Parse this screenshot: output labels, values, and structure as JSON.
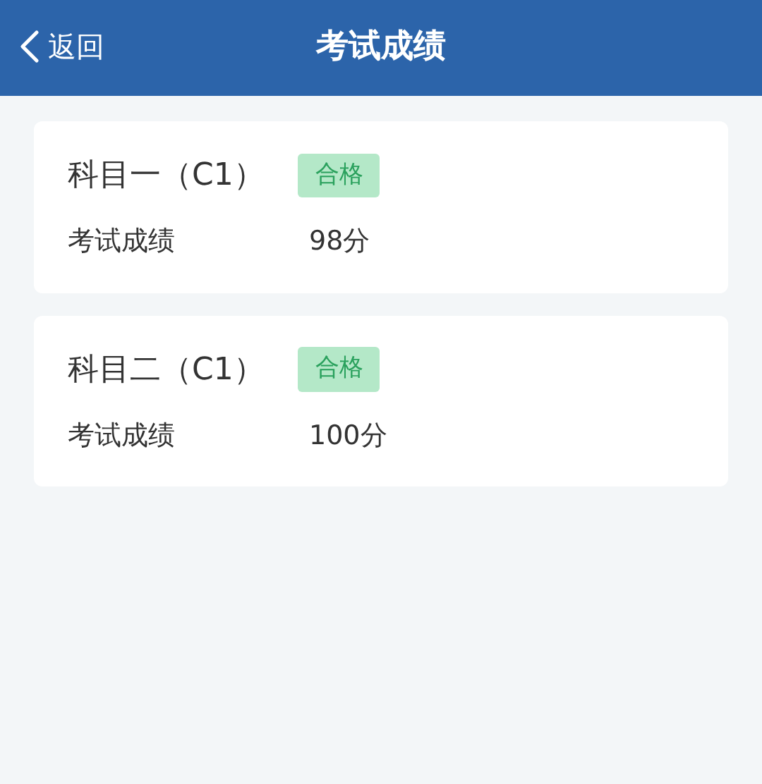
{
  "header": {
    "back_label": "返回",
    "title": "考试成绩"
  },
  "results": [
    {
      "subject": "科目一（C1）",
      "badge": "合格",
      "label": "考试成绩",
      "score": "98分"
    },
    {
      "subject": "科目二（C1）",
      "badge": "合格",
      "label": "考试成绩",
      "score": "100分"
    }
  ]
}
